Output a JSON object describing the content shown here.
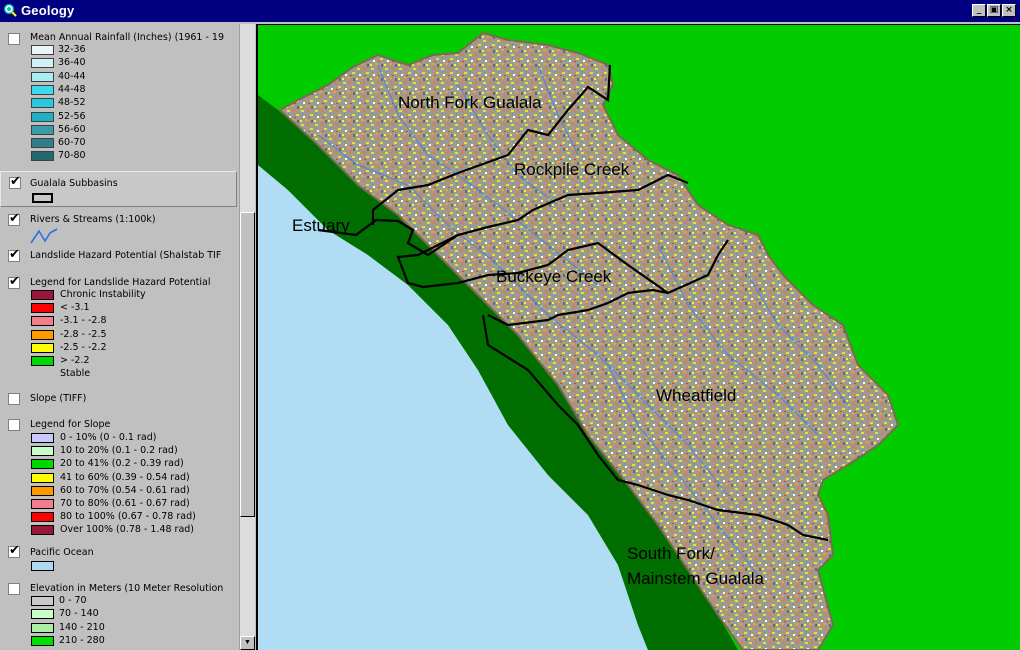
{
  "window": {
    "title": "Geology",
    "buttons": [
      "_",
      "▣",
      "×"
    ]
  },
  "toc": {
    "rainfall": {
      "name": "Mean Annual Rainfall (Inches) (1961 - 19",
      "checked": false,
      "classes": [
        {
          "label": "32-36",
          "color": "#e8f6f8"
        },
        {
          "label": "36-40",
          "color": "#d0f2f7"
        },
        {
          "label": "40-44",
          "color": "#a8ecf4"
        },
        {
          "label": "44-48",
          "color": "#40d8ec"
        },
        {
          "label": "48-52",
          "color": "#28c8de"
        },
        {
          "label": "52-56",
          "color": "#20b0c4"
        },
        {
          "label": "56-60",
          "color": "#3a9aa8"
        },
        {
          "label": "60-70",
          "color": "#2f7f8a"
        },
        {
          "label": "70-80",
          "color": "#256870"
        }
      ]
    },
    "subbasins": {
      "name": "Gualala Subbasins",
      "checked": true
    },
    "rivers": {
      "name": "Rivers & Streams (1:100k)",
      "checked": true
    },
    "landslide_tif": {
      "name": "Landslide Hazard Potential (Shalstab TIF",
      "checked": true
    },
    "landslide_legend": {
      "name": "Legend for Landslide Hazard Potential",
      "checked": true,
      "classes": [
        {
          "label": "Chronic Instability",
          "color": "#99183a"
        },
        {
          "label": "< -3.1",
          "color": "#ff0000"
        },
        {
          "label": "-3.1 - -2.8",
          "color": "#f47c8c"
        },
        {
          "label": "-2.8 - -2.5",
          "color": "#ff9900"
        },
        {
          "label": "-2.5 - -2.2",
          "color": "#ffff00"
        },
        {
          "label": "> -2.2",
          "color": "#00d800"
        },
        {
          "label": "Stable",
          "color": ""
        }
      ]
    },
    "slope_tiff": {
      "name": "Slope (TIFF)",
      "checked": false
    },
    "slope_legend": {
      "name": "Legend for Slope",
      "checked": false,
      "classes": [
        {
          "label": "0 - 10% (0 - 0.1 rad)",
          "color": "#c8c8ff"
        },
        {
          "label": "10 to 20% (0.1 - 0.2 rad)",
          "color": "#c8ffc8"
        },
        {
          "label": "20 to 41% (0.2 - 0.39 rad)",
          "color": "#00d800"
        },
        {
          "label": "41 to 60% (0.39 - 0.54 rad)",
          "color": "#ffff00"
        },
        {
          "label": "60 to 70% (0.54 - 0.61 rad)",
          "color": "#ff9900"
        },
        {
          "label": "70 to 80% (0.61 - 0.67 rad)",
          "color": "#f47c8c"
        },
        {
          "label": "80 to 100% (0.67 - 0.78 rad)",
          "color": "#ff0000"
        },
        {
          "label": "Over 100% (0.78 - 1.48 rad)",
          "color": "#99183a"
        }
      ]
    },
    "ocean": {
      "name": "Pacific Ocean",
      "checked": true,
      "color": "#b0d8f0"
    },
    "elevation": {
      "name": "Elevation in Meters (10 Meter Resolution",
      "checked": false,
      "classes": [
        {
          "label": "0 - 70",
          "color": "#c8c8c8"
        },
        {
          "label": "70 - 140",
          "color": "#c8ffc8"
        },
        {
          "label": "140 - 210",
          "color": "#a8f0a8"
        },
        {
          "label": "210 - 280",
          "color": "#00e000"
        }
      ]
    }
  },
  "map": {
    "labels": {
      "north_fork": "North Fork Gualala",
      "rockpile": "Rockpile Creek",
      "estuary": "Estuary",
      "buckeye": "Buckeye Creek",
      "wheatfield": "Wheatfield",
      "south_fork_1": "South Fork/",
      "south_fork_2": "Mainstem Gualala"
    },
    "colors": {
      "land": "#00cc00",
      "ocean": "#b0dcf4",
      "coast": "#006e00",
      "terrain": "#9a9a8c",
      "boundary": "#000000"
    }
  }
}
